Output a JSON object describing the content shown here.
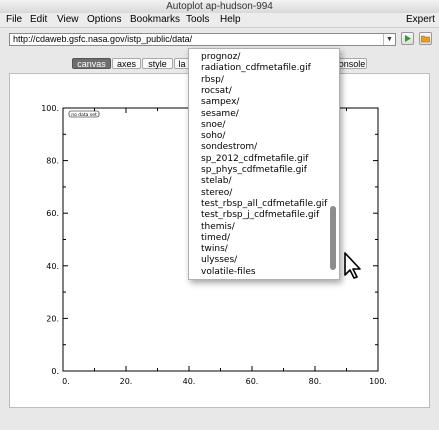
{
  "window": {
    "title": "Autoplot ap-hudson-994"
  },
  "menu": {
    "file": "File",
    "edit": "Edit",
    "view": "View",
    "options": "Options",
    "bookmarks": "Bookmarks",
    "tools": "Tools",
    "help": "Help",
    "expert": "Expert"
  },
  "address": {
    "value": "http://cdaweb.gsfc.nasa.gov/istp_public/data/"
  },
  "toolbar": {
    "go_icon": "play-icon",
    "browse_icon": "folder-icon"
  },
  "tabs": [
    {
      "label": "canvas",
      "active": true
    },
    {
      "label": "axes"
    },
    {
      "label": "style"
    },
    {
      "label": "la"
    },
    {
      "label": "onsole"
    }
  ],
  "plot": {
    "badge": "no data set",
    "x_ticks": [
      "0.",
      "20.",
      "40.",
      "60.",
      "80.",
      "100."
    ],
    "y_ticks": [
      "0.",
      "20.",
      "40.",
      "60.",
      "80.",
      "100."
    ]
  },
  "dropdown": {
    "items": [
      "prognoz/",
      "radiation_cdfmetafile.gif",
      "rbsp/",
      "rocsat/",
      "sampex/",
      "sesame/",
      "snoe/",
      "soho/",
      "sondestrom/",
      "sp_2012_cdfmetafile.gif",
      "sp_phys_cdfmetafile.gif",
      "stelab/",
      "stereo/",
      "test_rbsp_all_cdfmetafile.gif",
      "test_rbsp_j_cdfmetafile.gif",
      "themis/",
      "timed/",
      "twins/",
      "ulysses/",
      "volatile-files"
    ]
  },
  "colors": {
    "tab_active": "#6e6e6e",
    "go_button": "#3a9a3a",
    "browse_button": "#e0a020"
  }
}
